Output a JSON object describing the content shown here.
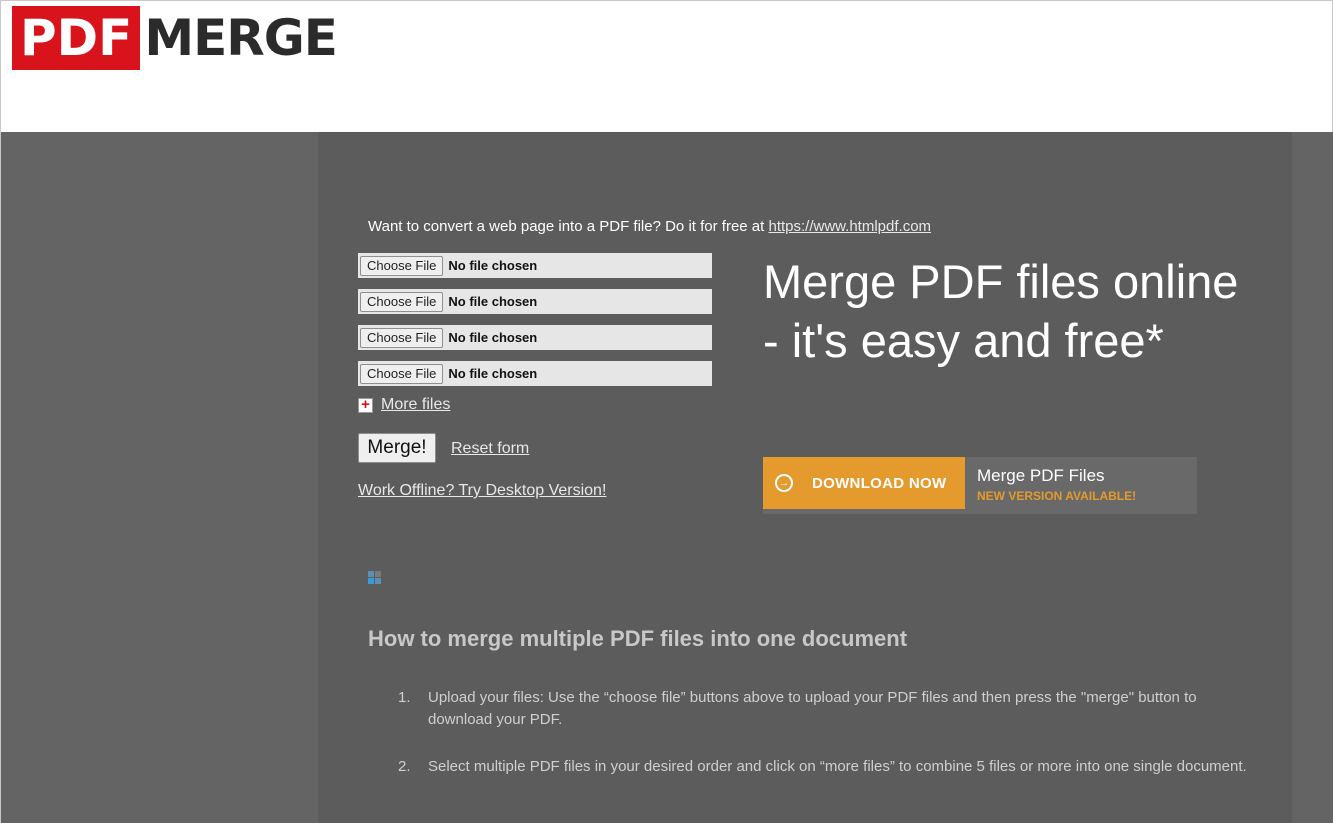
{
  "header": {
    "logo_pdf": "PDF",
    "logo_merge": "MERGE"
  },
  "promo": {
    "text": "Want to convert a web page into a PDF file? Do it for free at ",
    "link": "https://www.htmlpdf.com"
  },
  "file_inputs": [
    {
      "button": "Choose File",
      "status": "No file chosen"
    },
    {
      "button": "Choose File",
      "status": "No file chosen"
    },
    {
      "button": "Choose File",
      "status": "No file chosen"
    },
    {
      "button": "Choose File",
      "status": "No file chosen"
    }
  ],
  "more_files": {
    "icon": "plus-icon",
    "label": "More files"
  },
  "actions": {
    "merge": "Merge!",
    "reset": "Reset form",
    "offline": "Work Offline? Try Desktop Version!"
  },
  "hero": {
    "title": "Merge PDF files online - it's easy and free*"
  },
  "download": {
    "icon": "arrow-circle-icon",
    "button": "DOWNLOAD NOW",
    "title": "Merge PDF Files",
    "subtitle": "NEW VERSION AVAILABLE!"
  },
  "howto": {
    "title": "How to merge multiple PDF files into one document",
    "steps": [
      {
        "num": "1.",
        "text": "Upload your files: Use the “choose file” buttons above to upload your PDF files and then press the \"merge\" button to download your PDF."
      },
      {
        "num": "2.",
        "text": "Select multiple PDF files in your desired order and click on “more files” to combine 5 files or more into one single document."
      }
    ]
  },
  "colors": {
    "brand_red": "#d9131b",
    "download_orange": "#e49a2d",
    "page_bg": "#646464",
    "content_bg": "#5c5c5c"
  }
}
